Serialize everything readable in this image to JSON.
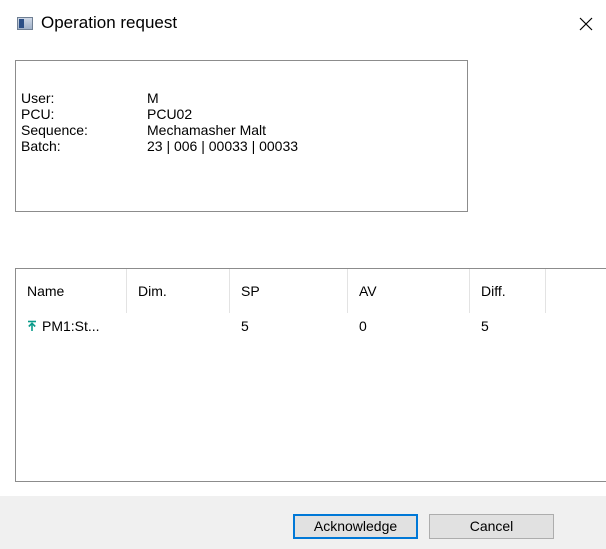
{
  "window": {
    "title": "Operation request",
    "app_icon": "window-app-icon",
    "close_icon": "close-icon"
  },
  "info": {
    "rows": [
      {
        "label": "User:",
        "value": "M"
      },
      {
        "label": "PCU:",
        "value": "PCU02"
      },
      {
        "label": "Sequence:",
        "value": "Mechamasher Malt"
      },
      {
        "label": "Batch:",
        "value": "23 | 006 | 00033 | 00033"
      }
    ]
  },
  "table": {
    "columns": [
      "Name",
      "Dim.",
      "SP",
      "AV",
      "Diff."
    ],
    "rows": [
      {
        "icon": "setpoint-arrow-icon",
        "name": "PM1:St...",
        "dim": "",
        "sp": "5",
        "av": "0",
        "diff": "5"
      }
    ],
    "accent_color": "#0a9b8a"
  },
  "footer": {
    "acknowledge_label": "Acknowledge",
    "cancel_label": "Cancel"
  }
}
